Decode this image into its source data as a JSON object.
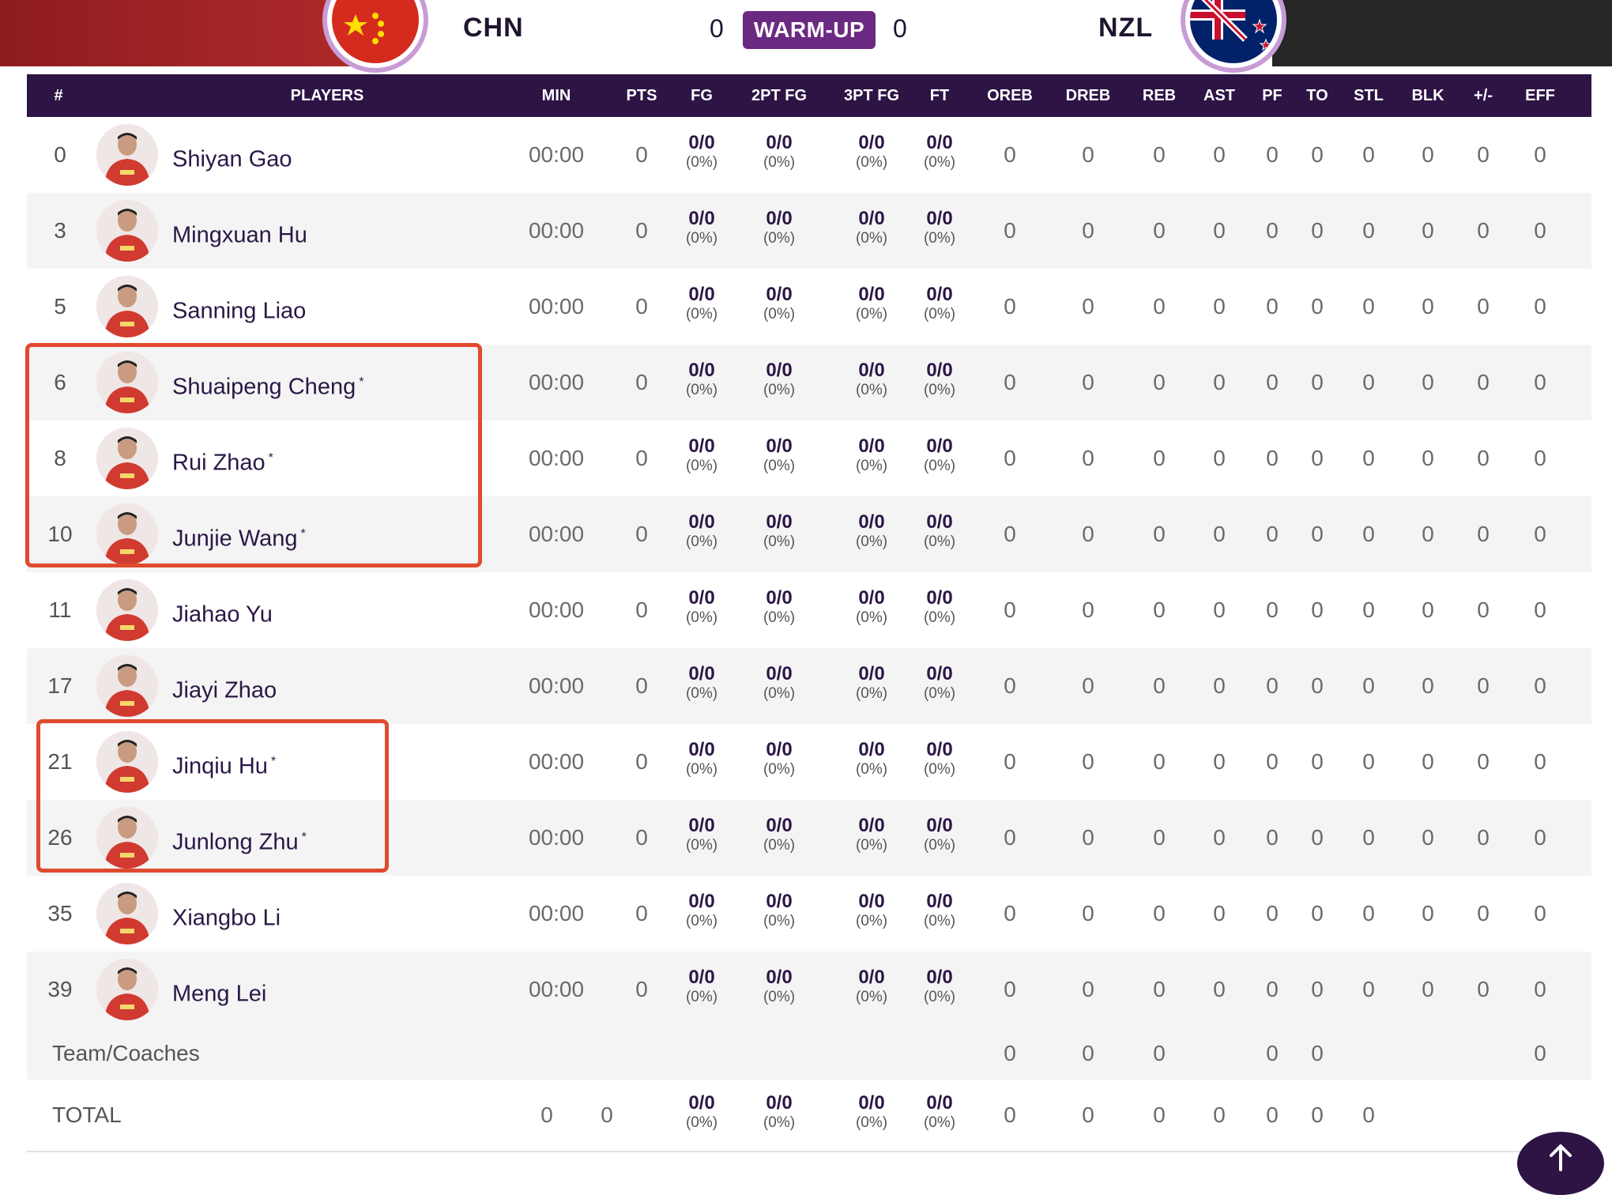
{
  "header": {
    "home_code": "CHN",
    "away_code": "NZL",
    "home_score": "0",
    "away_score": "0",
    "status": "WARM-UP",
    "home_flag_icon": "china-flag-icon",
    "away_flag_icon": "new-zealand-flag-icon",
    "colors": {
      "purple_dark": "#2d1445",
      "purple_badge": "#6b2a82",
      "home_red": "#b02a2a",
      "highlight": "#e04a2e"
    }
  },
  "table": {
    "columns": [
      "#",
      "PLAYERS",
      "MIN",
      "PTS",
      "FG",
      "2PT FG",
      "3PT FG",
      "FT",
      "OREB",
      "DREB",
      "REB",
      "AST",
      "PF",
      "TO",
      "STL",
      "BLK",
      "+/-",
      "EFF"
    ],
    "players": [
      {
        "number": "0",
        "name": "Shiyan Gao",
        "starter": "",
        "min": "00:00",
        "pts": "0",
        "fg": "0/0",
        "fg_pct": "(0%)",
        "fg2": "0/0",
        "fg2_pct": "(0%)",
        "fg3": "0/0",
        "fg3_pct": "(0%)",
        "ft": "0/0",
        "ft_pct": "(0%)",
        "oreb": "0",
        "dreb": "0",
        "reb": "0",
        "ast": "0",
        "pf": "0",
        "to": "0",
        "stl": "0",
        "blk": "0",
        "pm": "0",
        "eff": "0"
      },
      {
        "number": "3",
        "name": "Mingxuan Hu",
        "starter": "",
        "min": "00:00",
        "pts": "0",
        "fg": "0/0",
        "fg_pct": "(0%)",
        "fg2": "0/0",
        "fg2_pct": "(0%)",
        "fg3": "0/0",
        "fg3_pct": "(0%)",
        "ft": "0/0",
        "ft_pct": "(0%)",
        "oreb": "0",
        "dreb": "0",
        "reb": "0",
        "ast": "0",
        "pf": "0",
        "to": "0",
        "stl": "0",
        "blk": "0",
        "pm": "0",
        "eff": "0"
      },
      {
        "number": "5",
        "name": "Sanning Liao",
        "starter": "",
        "min": "00:00",
        "pts": "0",
        "fg": "0/0",
        "fg_pct": "(0%)",
        "fg2": "0/0",
        "fg2_pct": "(0%)",
        "fg3": "0/0",
        "fg3_pct": "(0%)",
        "ft": "0/0",
        "ft_pct": "(0%)",
        "oreb": "0",
        "dreb": "0",
        "reb": "0",
        "ast": "0",
        "pf": "0",
        "to": "0",
        "stl": "0",
        "blk": "0",
        "pm": "0",
        "eff": "0"
      },
      {
        "number": "6",
        "name": "Shuaipeng Cheng",
        "starter": "*",
        "min": "00:00",
        "pts": "0",
        "fg": "0/0",
        "fg_pct": "(0%)",
        "fg2": "0/0",
        "fg2_pct": "(0%)",
        "fg3": "0/0",
        "fg3_pct": "(0%)",
        "ft": "0/0",
        "ft_pct": "(0%)",
        "oreb": "0",
        "dreb": "0",
        "reb": "0",
        "ast": "0",
        "pf": "0",
        "to": "0",
        "stl": "0",
        "blk": "0",
        "pm": "0",
        "eff": "0"
      },
      {
        "number": "8",
        "name": "Rui Zhao",
        "starter": "*",
        "min": "00:00",
        "pts": "0",
        "fg": "0/0",
        "fg_pct": "(0%)",
        "fg2": "0/0",
        "fg2_pct": "(0%)",
        "fg3": "0/0",
        "fg3_pct": "(0%)",
        "ft": "0/0",
        "ft_pct": "(0%)",
        "oreb": "0",
        "dreb": "0",
        "reb": "0",
        "ast": "0",
        "pf": "0",
        "to": "0",
        "stl": "0",
        "blk": "0",
        "pm": "0",
        "eff": "0"
      },
      {
        "number": "10",
        "name": "Junjie Wang",
        "starter": "*",
        "min": "00:00",
        "pts": "0",
        "fg": "0/0",
        "fg_pct": "(0%)",
        "fg2": "0/0",
        "fg2_pct": "(0%)",
        "fg3": "0/0",
        "fg3_pct": "(0%)",
        "ft": "0/0",
        "ft_pct": "(0%)",
        "oreb": "0",
        "dreb": "0",
        "reb": "0",
        "ast": "0",
        "pf": "0",
        "to": "0",
        "stl": "0",
        "blk": "0",
        "pm": "0",
        "eff": "0"
      },
      {
        "number": "11",
        "name": "Jiahao Yu",
        "starter": "",
        "min": "00:00",
        "pts": "0",
        "fg": "0/0",
        "fg_pct": "(0%)",
        "fg2": "0/0",
        "fg2_pct": "(0%)",
        "fg3": "0/0",
        "fg3_pct": "(0%)",
        "ft": "0/0",
        "ft_pct": "(0%)",
        "oreb": "0",
        "dreb": "0",
        "reb": "0",
        "ast": "0",
        "pf": "0",
        "to": "0",
        "stl": "0",
        "blk": "0",
        "pm": "0",
        "eff": "0"
      },
      {
        "number": "17",
        "name": "Jiayi Zhao",
        "starter": "",
        "min": "00:00",
        "pts": "0",
        "fg": "0/0",
        "fg_pct": "(0%)",
        "fg2": "0/0",
        "fg2_pct": "(0%)",
        "fg3": "0/0",
        "fg3_pct": "(0%)",
        "ft": "0/0",
        "ft_pct": "(0%)",
        "oreb": "0",
        "dreb": "0",
        "reb": "0",
        "ast": "0",
        "pf": "0",
        "to": "0",
        "stl": "0",
        "blk": "0",
        "pm": "0",
        "eff": "0"
      },
      {
        "number": "21",
        "name": "Jinqiu Hu",
        "starter": "*",
        "min": "00:00",
        "pts": "0",
        "fg": "0/0",
        "fg_pct": "(0%)",
        "fg2": "0/0",
        "fg2_pct": "(0%)",
        "fg3": "0/0",
        "fg3_pct": "(0%)",
        "ft": "0/0",
        "ft_pct": "(0%)",
        "oreb": "0",
        "dreb": "0",
        "reb": "0",
        "ast": "0",
        "pf": "0",
        "to": "0",
        "stl": "0",
        "blk": "0",
        "pm": "0",
        "eff": "0"
      },
      {
        "number": "26",
        "name": "Junlong Zhu",
        "starter": "*",
        "min": "00:00",
        "pts": "0",
        "fg": "0/0",
        "fg_pct": "(0%)",
        "fg2": "0/0",
        "fg2_pct": "(0%)",
        "fg3": "0/0",
        "fg3_pct": "(0%)",
        "ft": "0/0",
        "ft_pct": "(0%)",
        "oreb": "0",
        "dreb": "0",
        "reb": "0",
        "ast": "0",
        "pf": "0",
        "to": "0",
        "stl": "0",
        "blk": "0",
        "pm": "0",
        "eff": "0"
      },
      {
        "number": "35",
        "name": "Xiangbo Li",
        "starter": "",
        "min": "00:00",
        "pts": "0",
        "fg": "0/0",
        "fg_pct": "(0%)",
        "fg2": "0/0",
        "fg2_pct": "(0%)",
        "fg3": "0/0",
        "fg3_pct": "(0%)",
        "ft": "0/0",
        "ft_pct": "(0%)",
        "oreb": "0",
        "dreb": "0",
        "reb": "0",
        "ast": "0",
        "pf": "0",
        "to": "0",
        "stl": "0",
        "blk": "0",
        "pm": "0",
        "eff": "0"
      },
      {
        "number": "39",
        "name": "Meng Lei",
        "starter": "",
        "min": "00:00",
        "pts": "0",
        "fg": "0/0",
        "fg_pct": "(0%)",
        "fg2": "0/0",
        "fg2_pct": "(0%)",
        "fg3": "0/0",
        "fg3_pct": "(0%)",
        "ft": "0/0",
        "ft_pct": "(0%)",
        "oreb": "0",
        "dreb": "0",
        "reb": "0",
        "ast": "0",
        "pf": "0",
        "to": "0",
        "stl": "0",
        "blk": "0",
        "pm": "0",
        "eff": "0"
      }
    ],
    "team_row": {
      "label": "Team/Coaches",
      "oreb": "0",
      "dreb": "0",
      "reb": "0",
      "pf": "0",
      "to": "0",
      "eff": "0"
    },
    "total_row": {
      "label": "TOTAL",
      "min": "0",
      "pts": "0",
      "fg": "0/0",
      "fg_pct": "(0%)",
      "fg2": "0/0",
      "fg2_pct": "(0%)",
      "fg3": "0/0",
      "fg3_pct": "(0%)",
      "ft": "0/0",
      "ft_pct": "(0%)",
      "oreb": "0",
      "dreb": "0",
      "reb": "0",
      "ast": "0",
      "pf": "0",
      "to": "0",
      "stl": "0"
    }
  },
  "back_to_top_icon": "arrow-up-icon"
}
